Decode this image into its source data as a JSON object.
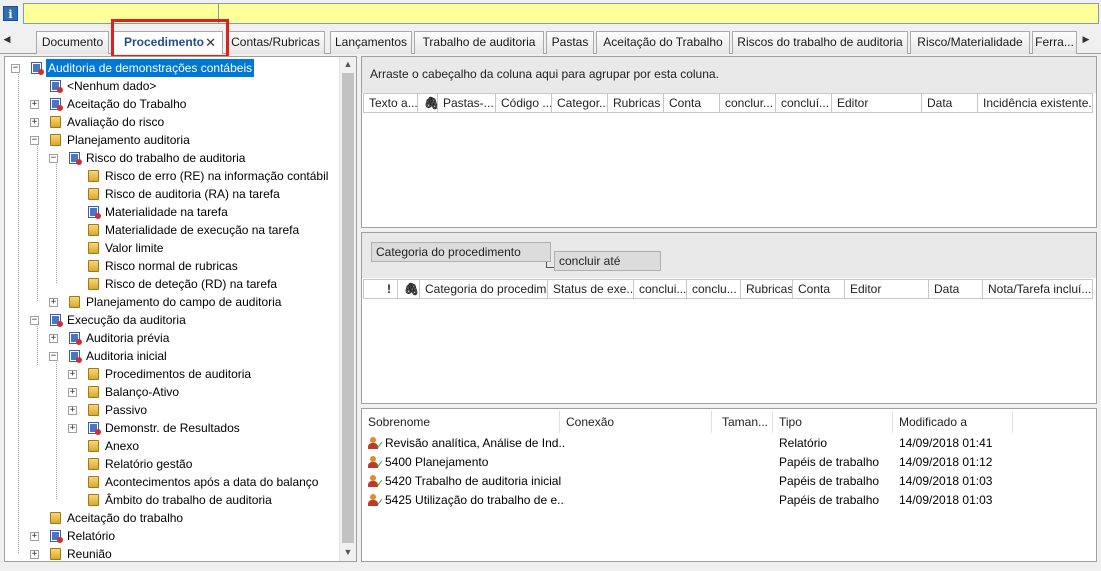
{
  "tabs": [
    {
      "label": "Documento"
    },
    {
      "label": "Procedimento",
      "active": true
    },
    {
      "label": "Contas/Rubricas"
    },
    {
      "label": "Lançamentos"
    },
    {
      "label": "Trabalho de auditoria"
    },
    {
      "label": "Pastas"
    },
    {
      "label": "Aceitação do Trabalho"
    },
    {
      "label": "Riscos do trabalho de auditoria"
    },
    {
      "label": "Risco/Materialidade"
    },
    {
      "label": "Ferra..."
    }
  ],
  "tree": {
    "root": "Auditoria de demonstrações contábeis",
    "nodes": {
      "nenhum": "<Nenhum dado>",
      "aceitacao": "Aceitação do Trabalho",
      "avaliacao": "Avaliação do risco",
      "planejamento": "Planejamento auditoria",
      "risco_trabalho": "Risco do trabalho de auditoria",
      "risco_erro": "Risco de erro (RE) na informação contábil",
      "risco_auditoria": "Risco de auditoria (RA) na tarefa",
      "materialidade": "Materialidade na tarefa",
      "mat_execucao": "Materialidade de execução na tarefa",
      "valor_limite": "Valor limite",
      "risco_normal": "Risco normal de rubricas",
      "risco_detecao": "Risco de deteção (RD) na tarefa",
      "plan_campo": "Planejamento do campo de auditoria",
      "execucao": "Execução da auditoria",
      "aud_previa": "Auditoria prévia",
      "aud_inicial": "Auditoria inicial",
      "procedimentos": "Procedimentos de auditoria",
      "balanco": "Balanço-Ativo",
      "passivo": "Passivo",
      "demonstr": "Demonstr. de Resultados",
      "anexo": "Anexo",
      "relatorio_gestao": "Relatório gestão",
      "acontecimentos": "Acontecimentos após a data do balanço",
      "ambito": "Âmbito do trabalho de auditoria",
      "aceitacao2": "Aceitação do trabalho",
      "relatorio": "Relatório",
      "reuniao": "Reunião"
    }
  },
  "grid1": {
    "hint": "Arraste o cabeçalho da coluna aqui para agrupar por esta coluna.",
    "columns": [
      "Texto a...",
      "",
      "Pastas-...",
      "Código ...",
      "Categor...",
      "Rubricas",
      "Conta",
      "conclur...",
      "concluí...",
      "Editor",
      "Data",
      "Incidência existente..."
    ]
  },
  "grid2": {
    "group1": "Categoria do procedimento",
    "group2": "concluir até",
    "columns": [
      "!",
      "",
      "Categoria do procedim...",
      "Status de exe...",
      "conclui...",
      "conclu...",
      "Rubricas",
      "Conta",
      "Editor",
      "Data",
      "Nota/Tarefa incluí..."
    ]
  },
  "files": {
    "columns": [
      "Sobrenome",
      "Conexão",
      "Taman...",
      "Tipo",
      "Modificado a"
    ],
    "rows": [
      {
        "name": "Revisão analítica, Análise de Ind...",
        "type": "Relatório",
        "modified": "14/09/2018 01:41"
      },
      {
        "name": "5400 Planejamento",
        "type": "Papéis de trabalho",
        "modified": "14/09/2018 01:12"
      },
      {
        "name": "5420 Trabalho de auditoria inicial",
        "type": "Papéis de trabalho",
        "modified": "14/09/2018 01:03"
      },
      {
        "name": "5425 Utilização do trabalho de e...",
        "type": "Papéis de trabalho",
        "modified": "14/09/2018 01:03"
      }
    ]
  },
  "icons": {
    "info": "info-icon",
    "attachment": "paperclip-icon",
    "close_tab": "close-icon",
    "folder": "folder-icon",
    "document": "document-icon",
    "user_file": "user-check-icon"
  },
  "colors": {
    "selection": "#0078d7",
    "infobar": "#ffff99",
    "highlight": "#e02020",
    "tab_active_text": "#1f4e8c"
  }
}
